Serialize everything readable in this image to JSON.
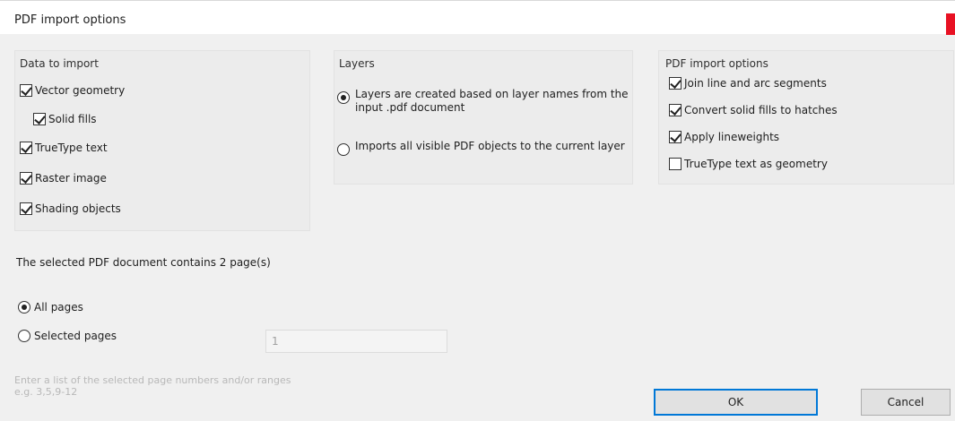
{
  "window": {
    "title": "PDF import options"
  },
  "data_to_import": {
    "title": "Data to import",
    "items": [
      {
        "label": "Vector geometry",
        "checked": true
      },
      {
        "label": "Solid fills",
        "checked": true
      },
      {
        "label": "TrueType text",
        "checked": true
      },
      {
        "label": "Raster image",
        "checked": true
      },
      {
        "label": "Shading objects",
        "checked": true
      }
    ]
  },
  "layers": {
    "title": "Layers",
    "options": [
      {
        "label": "Layers are created based on layer names from the input .pdf document",
        "selected": true
      },
      {
        "label": "Imports all visible PDF objects to the current layer",
        "selected": false
      }
    ]
  },
  "pdf_import_options": {
    "title": "PDF import options",
    "items": [
      {
        "label": "Join line and arc segments",
        "checked": true
      },
      {
        "label": "Convert solid fills to hatches",
        "checked": true
      },
      {
        "label": "Apply lineweights",
        "checked": true
      },
      {
        "label": "TrueType text as geometry",
        "checked": false
      }
    ]
  },
  "document_info": "The selected PDF document contains 2 page(s)",
  "pages": {
    "all_label": "All pages",
    "all_selected": true,
    "selected_label": "Selected pages",
    "selected_selected": false,
    "input_value": "1",
    "hint_line1": "Enter a list of the selected page numbers and/or ranges",
    "hint_line2": "e.g. 3,5,9-12"
  },
  "buttons": {
    "ok": "OK",
    "cancel": "Cancel"
  }
}
